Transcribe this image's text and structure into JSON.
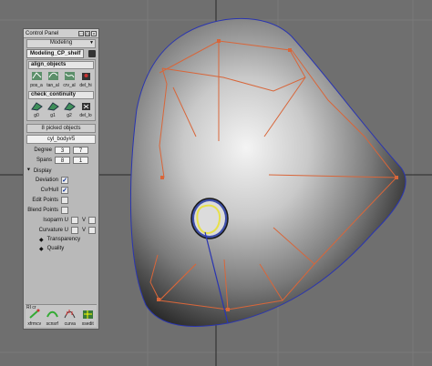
{
  "colors": {
    "viewport_bg": "#6f6f6f",
    "surface_light": "#f2f2f2",
    "surface_dark": "#1a1a1a",
    "hull": "#d8663a",
    "curve": "#e7e04a",
    "blue_curve": "#2a35b0",
    "panel_bg": "#b9b9b9"
  },
  "panel": {
    "title": "Control Panel",
    "mode": "Modeling",
    "shelf_tab": "Modeling_CP_shelf",
    "align_group": {
      "label": "align_objects",
      "tools": [
        {
          "label": "pos_a",
          "icon": "align-position-icon"
        },
        {
          "label": "tan_al",
          "icon": "align-tangent-icon"
        },
        {
          "label": "crv_al",
          "icon": "align-curvature-icon"
        },
        {
          "label": "del_hi",
          "icon": "delete-history-icon"
        }
      ]
    },
    "continuity_group": {
      "label": "check_continuity",
      "tools": [
        {
          "label": "g0",
          "icon": "continuity-g0-icon"
        },
        {
          "label": "g1",
          "icon": "continuity-g1-icon"
        },
        {
          "label": "g2",
          "icon": "continuity-g2-icon"
        },
        {
          "label": "del_lo",
          "icon": "delete-locator-icon"
        }
      ]
    },
    "picked": "8 picked objects",
    "object_name": "cyl_body#5",
    "degree": {
      "label": "Degree",
      "u": "3",
      "v": "7"
    },
    "spans": {
      "label": "Spans",
      "u": "8",
      "v": "1"
    },
    "display_header": "Display",
    "options": [
      {
        "label": "Deviation",
        "checked": true
      },
      {
        "label": "Cv/Hull",
        "checked": true
      },
      {
        "label": "Edit Points",
        "checked": false
      },
      {
        "label": "Blend Points",
        "checked": false
      }
    ],
    "isoparm": {
      "label": "Isoparm U",
      "v_label": "V"
    },
    "curvature": {
      "label": "Curvature U",
      "v_label": "V"
    },
    "transparency": "Transparency",
    "quality": "Quality",
    "bottom_shelf": {
      "tag": "RI cr",
      "tools": [
        {
          "label": "xfrmcv",
          "icon": "transform-cv-icon"
        },
        {
          "label": "scnsrf",
          "icon": "scan-surface-icon"
        },
        {
          "label": "curva",
          "icon": "curvature-icon"
        },
        {
          "label": "xsedit",
          "icon": "cross-section-edit-icon"
        }
      ]
    }
  }
}
